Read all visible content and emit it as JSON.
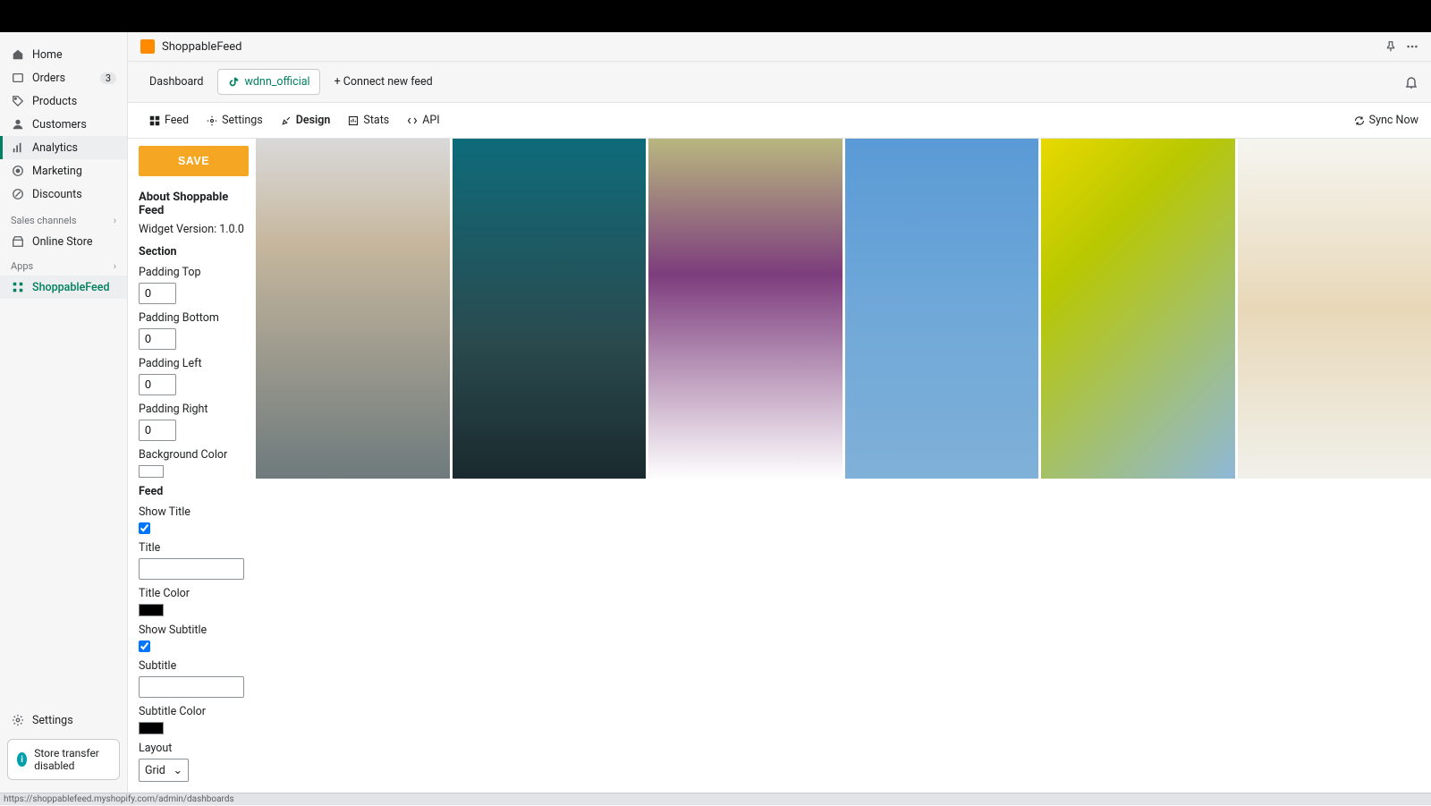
{
  "sidebar": {
    "items": [
      {
        "label": "Home"
      },
      {
        "label": "Orders",
        "badge": "3"
      },
      {
        "label": "Products"
      },
      {
        "label": "Customers"
      },
      {
        "label": "Analytics"
      },
      {
        "label": "Marketing"
      },
      {
        "label": "Discounts"
      }
    ],
    "sales_channels_heading": "Sales channels",
    "online_store": "Online Store",
    "apps_heading": "Apps",
    "app_item": "ShoppableFeed",
    "settings": "Settings",
    "transfer_pill": "Store transfer disabled"
  },
  "app_header": {
    "title": "ShoppableFeed"
  },
  "tabs": {
    "dashboard": "Dashboard",
    "feed_account": "wdnn_official",
    "connect": "+ Connect new feed"
  },
  "subtabs": {
    "feed": "Feed",
    "settings": "Settings",
    "design": "Design",
    "stats": "Stats",
    "api": "API",
    "sync": "Sync Now"
  },
  "design": {
    "save": "SAVE",
    "about_heading": "About Shoppable Feed",
    "widget_version_label": "Widget Version: 1.0.0",
    "section_heading": "Section",
    "padding_top_label": "Padding Top",
    "padding_top_value": "0",
    "padding_bottom_label": "Padding Bottom",
    "padding_bottom_value": "0",
    "padding_left_label": "Padding Left",
    "padding_left_value": "0",
    "padding_right_label": "Padding Right",
    "padding_right_value": "0",
    "bg_color_label": "Background Color",
    "feed_heading": "Feed",
    "show_title_label": "Show Title",
    "title_label": "Title",
    "title_value": "",
    "title_color_label": "Title Color",
    "show_subtitle_label": "Show Subtitle",
    "subtitle_label": "Subtitle",
    "subtitle_value": "",
    "subtitle_color_label": "Subtitle Color",
    "layout_label": "Layout",
    "layout_value": "Grid"
  },
  "statusbar": {
    "url": "https://shoppablefeed.myshopify.com/admin/dashboards"
  }
}
